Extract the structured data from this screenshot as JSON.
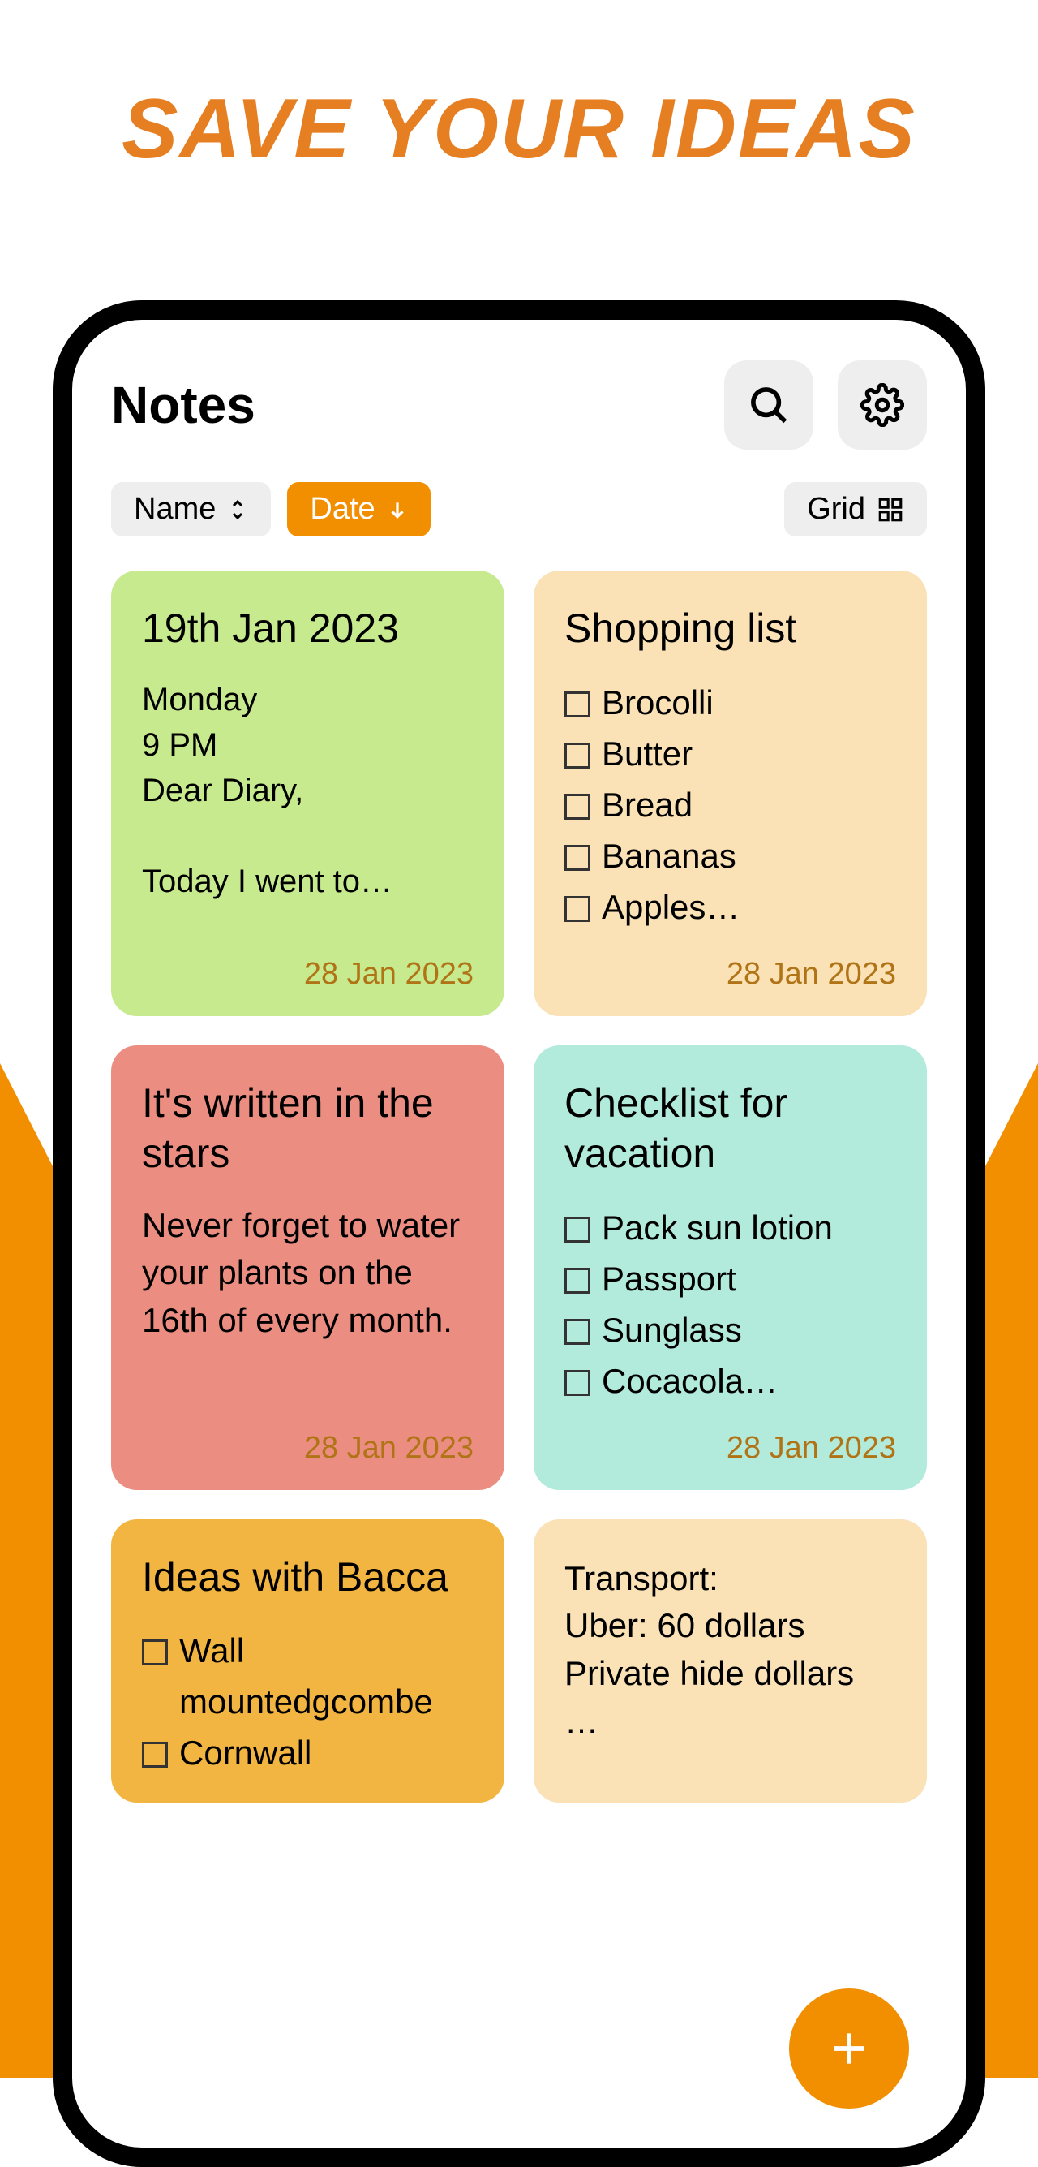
{
  "hero": "SAVE YOUR IDEAS",
  "header": {
    "title": "Notes"
  },
  "chips": {
    "name": "Name",
    "date": "Date",
    "grid": "Grid"
  },
  "notes": {
    "n1": {
      "title": "19th Jan 2023",
      "body": "Monday\n9 PM\nDear Diary,\n\nToday I went to…",
      "date": "28 Jan 2023"
    },
    "n2": {
      "title": "Shopping list",
      "items": [
        "Brocolli",
        "Butter",
        "Bread",
        "Bananas",
        "Apples…"
      ],
      "date": "28 Jan 2023"
    },
    "n3": {
      "title": "It's written in the stars",
      "body": "Never forget to water your plants on the 16th of every month.",
      "date": "28 Jan 2023"
    },
    "n4": {
      "title": "Checklist for vacation",
      "items": [
        "Pack sun lotion",
        "Passport",
        "Sunglass",
        "Cocacola…"
      ],
      "date": "28 Jan 2023"
    },
    "n5": {
      "title": "Ideas with Bacca",
      "items": [
        "Wall mountedgcombe",
        "Cornwall"
      ]
    },
    "n6": {
      "body": "Transport:\nUber: 60 dollars\nPrivate hide dollars\n…"
    }
  }
}
